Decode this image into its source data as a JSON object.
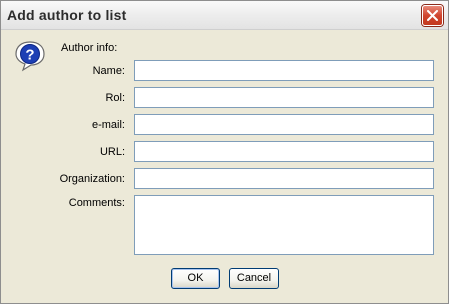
{
  "window": {
    "title": "Add author to list"
  },
  "icons": {
    "help": "question-mark-balloon-icon",
    "close": "close-x-icon"
  },
  "form": {
    "section_label": "Author info:",
    "fields": [
      {
        "label": "Name:",
        "value": ""
      },
      {
        "label": "Rol:",
        "value": ""
      },
      {
        "label": "e-mail:",
        "value": ""
      },
      {
        "label": "URL:",
        "value": ""
      },
      {
        "label": "Organization:",
        "value": ""
      }
    ],
    "comments": {
      "label": "Comments:",
      "value": ""
    }
  },
  "buttons": {
    "ok": "OK",
    "cancel": "Cancel"
  },
  "colors": {
    "dialog_bg": "#ece9d8",
    "close_button": "#d0452f",
    "input_border": "#7f9db9"
  }
}
